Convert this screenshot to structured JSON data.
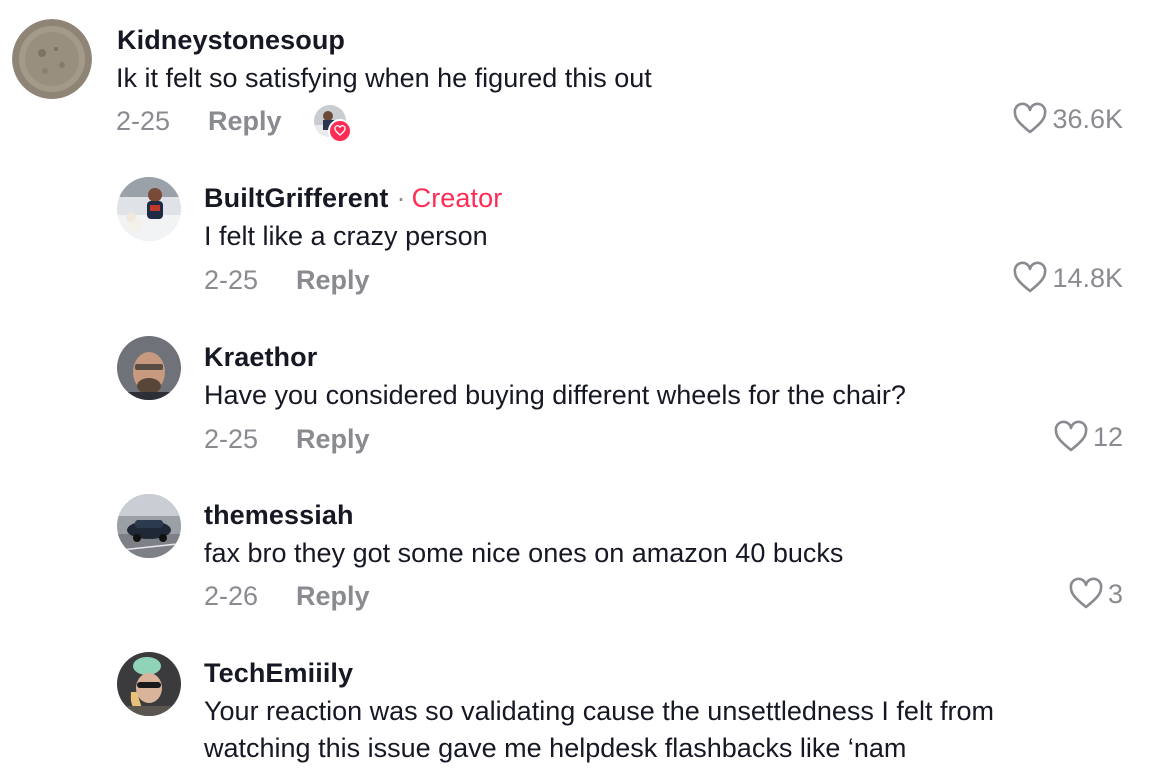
{
  "comments": [
    {
      "username": "Kidneystonesoup",
      "text": "Ik it felt so satisfying when he figured this out",
      "date": "2-25",
      "reply_label": "Reply",
      "likes": "36.6K",
      "creator_liked": true
    },
    {
      "username": "BuiltGrifferent",
      "creator_sep": "·",
      "creator_label": "Creator",
      "text": "I felt like a crazy person",
      "date": "2-25",
      "reply_label": "Reply",
      "likes": "14.8K"
    },
    {
      "username": "Kraethor",
      "text": "Have you considered buying different wheels for the chair?",
      "date": "2-25",
      "reply_label": "Reply",
      "likes": "12"
    },
    {
      "username": "themessiah",
      "text": "fax bro they got some nice ones on amazon 40 bucks",
      "date": "2-26",
      "reply_label": "Reply",
      "likes": "3"
    },
    {
      "username": "TechEmiiily",
      "text_lines": [
        "Your reaction was so validating cause the unsettledness I felt from",
        "watching this issue gave me helpdesk flashbacks like ‘nam"
      ]
    }
  ],
  "colors": {
    "text": "#161823",
    "muted": "#8a8b91",
    "creator": "#fe2c55"
  },
  "icons": {
    "like": "heart-outline-icon",
    "creator_liked": "heart-badge-icon"
  }
}
